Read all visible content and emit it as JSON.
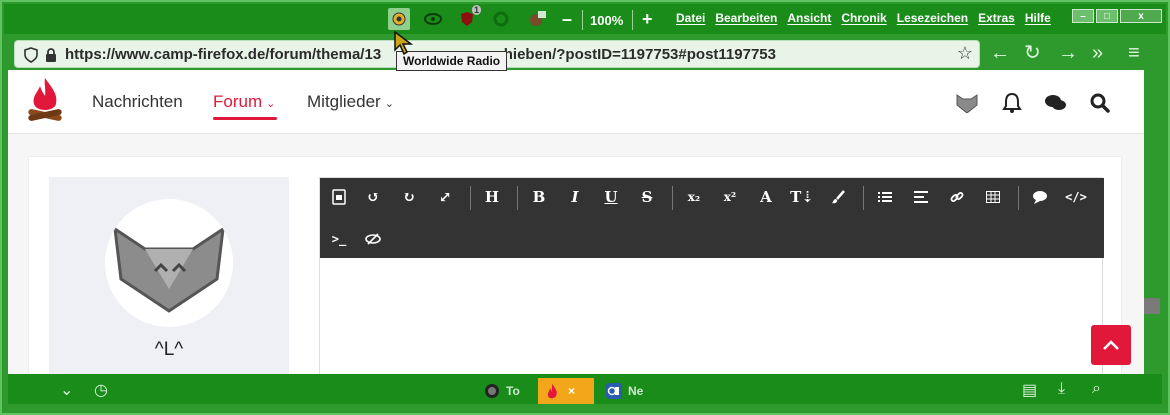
{
  "browser": {
    "zoom": "100%",
    "zoom_minus": "–",
    "zoom_plus": "+",
    "menu": [
      "Datei",
      "Bearbeiten",
      "Ansicht",
      "Chronik",
      "Lesezeichen",
      "Extras",
      "Hilfe"
    ],
    "url": "https://www.camp-firefox.de/forum/thema/13",
    "url_rest": "verschieben/?postID=1197753#post1197753",
    "tooltip": "Worldwide Radio",
    "addon_badge": "1",
    "window_controls": {
      "minimize": "–",
      "maximize": "□",
      "close": "x"
    },
    "tabs": [
      {
        "label": "To",
        "active": false
      },
      {
        "label": "",
        "close": "×",
        "active": true
      },
      {
        "label": "Ne",
        "active": false
      }
    ]
  },
  "site": {
    "nav": [
      {
        "label": "Nachrichten",
        "active": false
      },
      {
        "label": "Forum",
        "active": true,
        "chevron": "⌄"
      },
      {
        "label": "Mitglieder",
        "active": false,
        "chevron": "⌄"
      }
    ],
    "accent_color": "#e2183a"
  },
  "post": {
    "username": "^L^"
  },
  "editor": {
    "toolbar_row1": [
      "source-icon",
      "undo-icon",
      "redo-icon",
      "fullscreen-icon",
      "heading",
      "bold",
      "italic",
      "underline",
      "strikethrough",
      "subscript",
      "superscript",
      "font-color",
      "font-size",
      "paint-brush-icon",
      "list-icon",
      "align-icon",
      "link-icon",
      "table-icon",
      "quote-icon",
      "code-icon"
    ],
    "toolbar_row2": [
      "terminal-icon",
      "spoiler-icon"
    ],
    "labels": {
      "heading": "H",
      "bold": "B",
      "italic": "I",
      "underline": "U",
      "strike": "S",
      "sub": "x₂",
      "sup": "x²",
      "font": "A",
      "size": "T⇣",
      "terminal": ">_"
    }
  }
}
